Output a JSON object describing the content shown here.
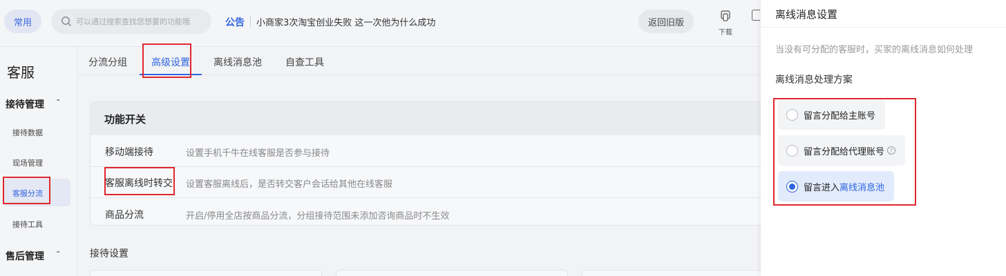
{
  "topbar": {
    "pinned_label": "常用",
    "search_placeholder": "可以通过搜索查找您想要的功能哦",
    "notice_label": "公告",
    "notice_text": "小商家3次淘宝创业失败 这一次他为什么成功",
    "back_button": "返回旧版",
    "download_label": "下载"
  },
  "sidebar": {
    "title": "客服",
    "groups": [
      {
        "label": "接待管理",
        "items": [
          "接待数据",
          "现场管理",
          "客服分流",
          "接待工具"
        ]
      },
      {
        "label": "售后管理",
        "items": []
      }
    ],
    "active_item": "客服分流"
  },
  "tabs": [
    "分流分组",
    "高级设置",
    "离线消息池",
    "自查工具"
  ],
  "active_tab": "高级设置",
  "feature_panel": {
    "title": "功能开关",
    "rows": [
      {
        "label": "移动端接待",
        "desc": "设置手机千牛在线客服是否参与接待"
      },
      {
        "label": "客服离线时转交",
        "desc": "设置客服离线后，是否转交客户会话给其他在线客服"
      },
      {
        "label": "商品分流",
        "desc": "开启/停用全店按商品分流，分组接待范围未添加咨询商品时不生效"
      }
    ]
  },
  "reception_settings_label": "接待设置",
  "drawer": {
    "title": "离线消息设置",
    "desc": "当没有可分配的客服时，买家的离线消息如何处理",
    "subtitle": "离线消息处理方案",
    "options": [
      {
        "label": "留言分配给主账号",
        "selected": false
      },
      {
        "label": "留言分配给代理账号",
        "selected": false,
        "has_help": true
      },
      {
        "label_prefix": "留言进入",
        "label_link": "离线消息池",
        "selected": true
      }
    ]
  },
  "colors": {
    "accent": "#2f64e0",
    "highlight_box": "#e0262c"
  }
}
